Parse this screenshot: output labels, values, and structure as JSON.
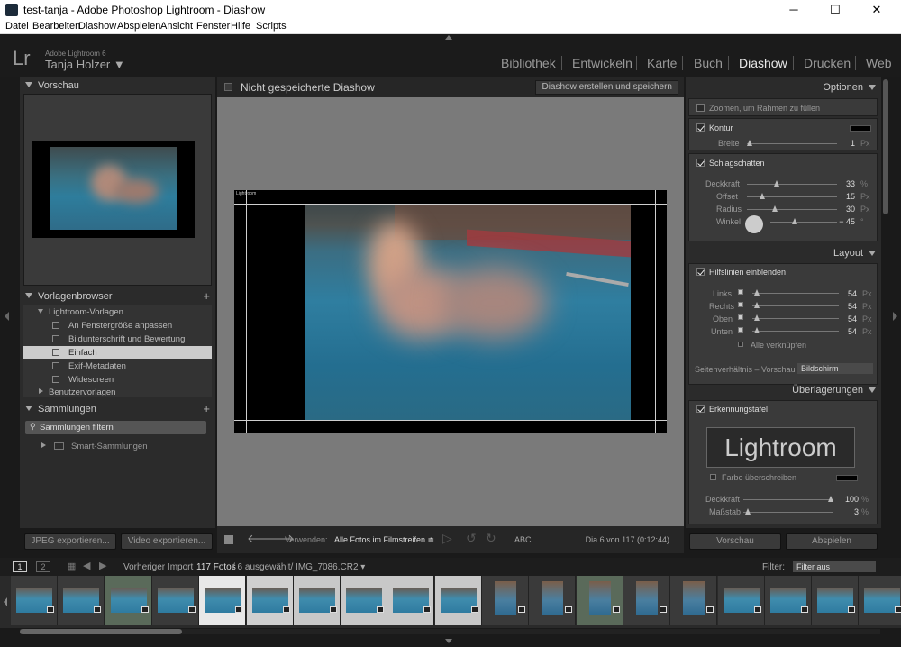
{
  "window": {
    "title": "test-tanja - Adobe Photoshop Lightroom - Diashow",
    "minimize": "─",
    "maximize": "☐",
    "close": "✕"
  },
  "menu": [
    "Datei",
    "Bearbeiten",
    "Diashow",
    "Abspielen",
    "Ansicht",
    "Fenster",
    "Hilfe",
    "Scripts"
  ],
  "identity": {
    "logo": "Lr",
    "product": "Adobe Lightroom 6",
    "user": "Tanja Holzer ▼"
  },
  "modules": [
    "Bibliothek",
    "Entwickeln",
    "Karte",
    "Buch",
    "Diashow",
    "Drucken",
    "Web"
  ],
  "active_module": "Diashow",
  "left": {
    "preview_title": "Vorschau",
    "templates_title": "Vorlagenbrowser",
    "templates_group": "Lightroom-Vorlagen",
    "templates": [
      "An Fenstergröße anpassen",
      "Bildunterschrift und Bewertung",
      "Einfach",
      "Exif-Metadaten",
      "Widescreen"
    ],
    "selected_template": "Einfach",
    "user_templates": "Benutzervorlagen",
    "collections_title": "Sammlungen",
    "filter_placeholder": "Sammlungen filtern",
    "smart_collections": "Smart-Sammlungen",
    "export_jpeg": "JPEG exportieren...",
    "export_video": "Video exportieren..."
  },
  "center": {
    "title": "Nicht gespeicherte Diashow",
    "create_button": "Diashow erstellen und speichern",
    "identity_plate_small": "Lightroom",
    "use_label": "Verwenden:",
    "use_value": "Alle Fotos im Filmstreifen ≑",
    "abc": "ABC",
    "status": "Dia 6 von 117 (0:12:44)"
  },
  "right": {
    "options_title": "Optionen",
    "zoom_label": "Zoomen, um Rahmen zu füllen",
    "stroke_label": "Kontur",
    "width_label": "Breite",
    "width_value": "1",
    "shadow_label": "Schlagschatten",
    "opacity_label": "Deckkraft",
    "opacity_value": "33",
    "offset_label": "Offset",
    "offset_value": "15",
    "radius_label": "Radius",
    "radius_value": "30",
    "angle_label": "Winkel",
    "angle_value": "− 45",
    "layout_title": "Layout",
    "guides_label": "Hilfslinien einblenden",
    "left_label": "Links",
    "left_value": "54",
    "right_label": "Rechts",
    "right_value": "54",
    "top_label": "Oben",
    "top_value": "54",
    "bottom_label": "Unten",
    "bottom_value": "54",
    "link_all": "Alle verknüpfen",
    "aspect_label": "Seitenverhältnis – Vorschau",
    "aspect_value": "Bildschirm",
    "overlays_title": "Überlagerungen",
    "plate_label": "Erkennungstafel",
    "plate_text": "Lightroom",
    "override_color": "Farbe überschreiben",
    "plate_opacity_label": "Deckkraft",
    "plate_opacity_value": "100",
    "scale_label": "Maßstab",
    "scale_value": "3",
    "unit_px": "Px",
    "unit_pct": "%",
    "unit_deg": "°",
    "preview_button": "Vorschau",
    "play_button": "Abspielen"
  },
  "filmstrip": {
    "page1": "1",
    "page2": "2",
    "source": "Vorheriger Import",
    "count": "117 Fotos",
    "details": "/ 6 ausgewählt/ IMG_7086.CR2 ▾",
    "filter_label": "Filter:",
    "filter_value": "Filter aus"
  },
  "colors": {
    "accent_selected": "#cccccc",
    "panel": "#2b2b2b",
    "workspace": "#7a7a7a"
  },
  "state": {
    "zoom_fill": false,
    "stroke": true,
    "shadow": true,
    "guides": true,
    "link_all": false,
    "identity_plate": true,
    "override_color": false
  }
}
